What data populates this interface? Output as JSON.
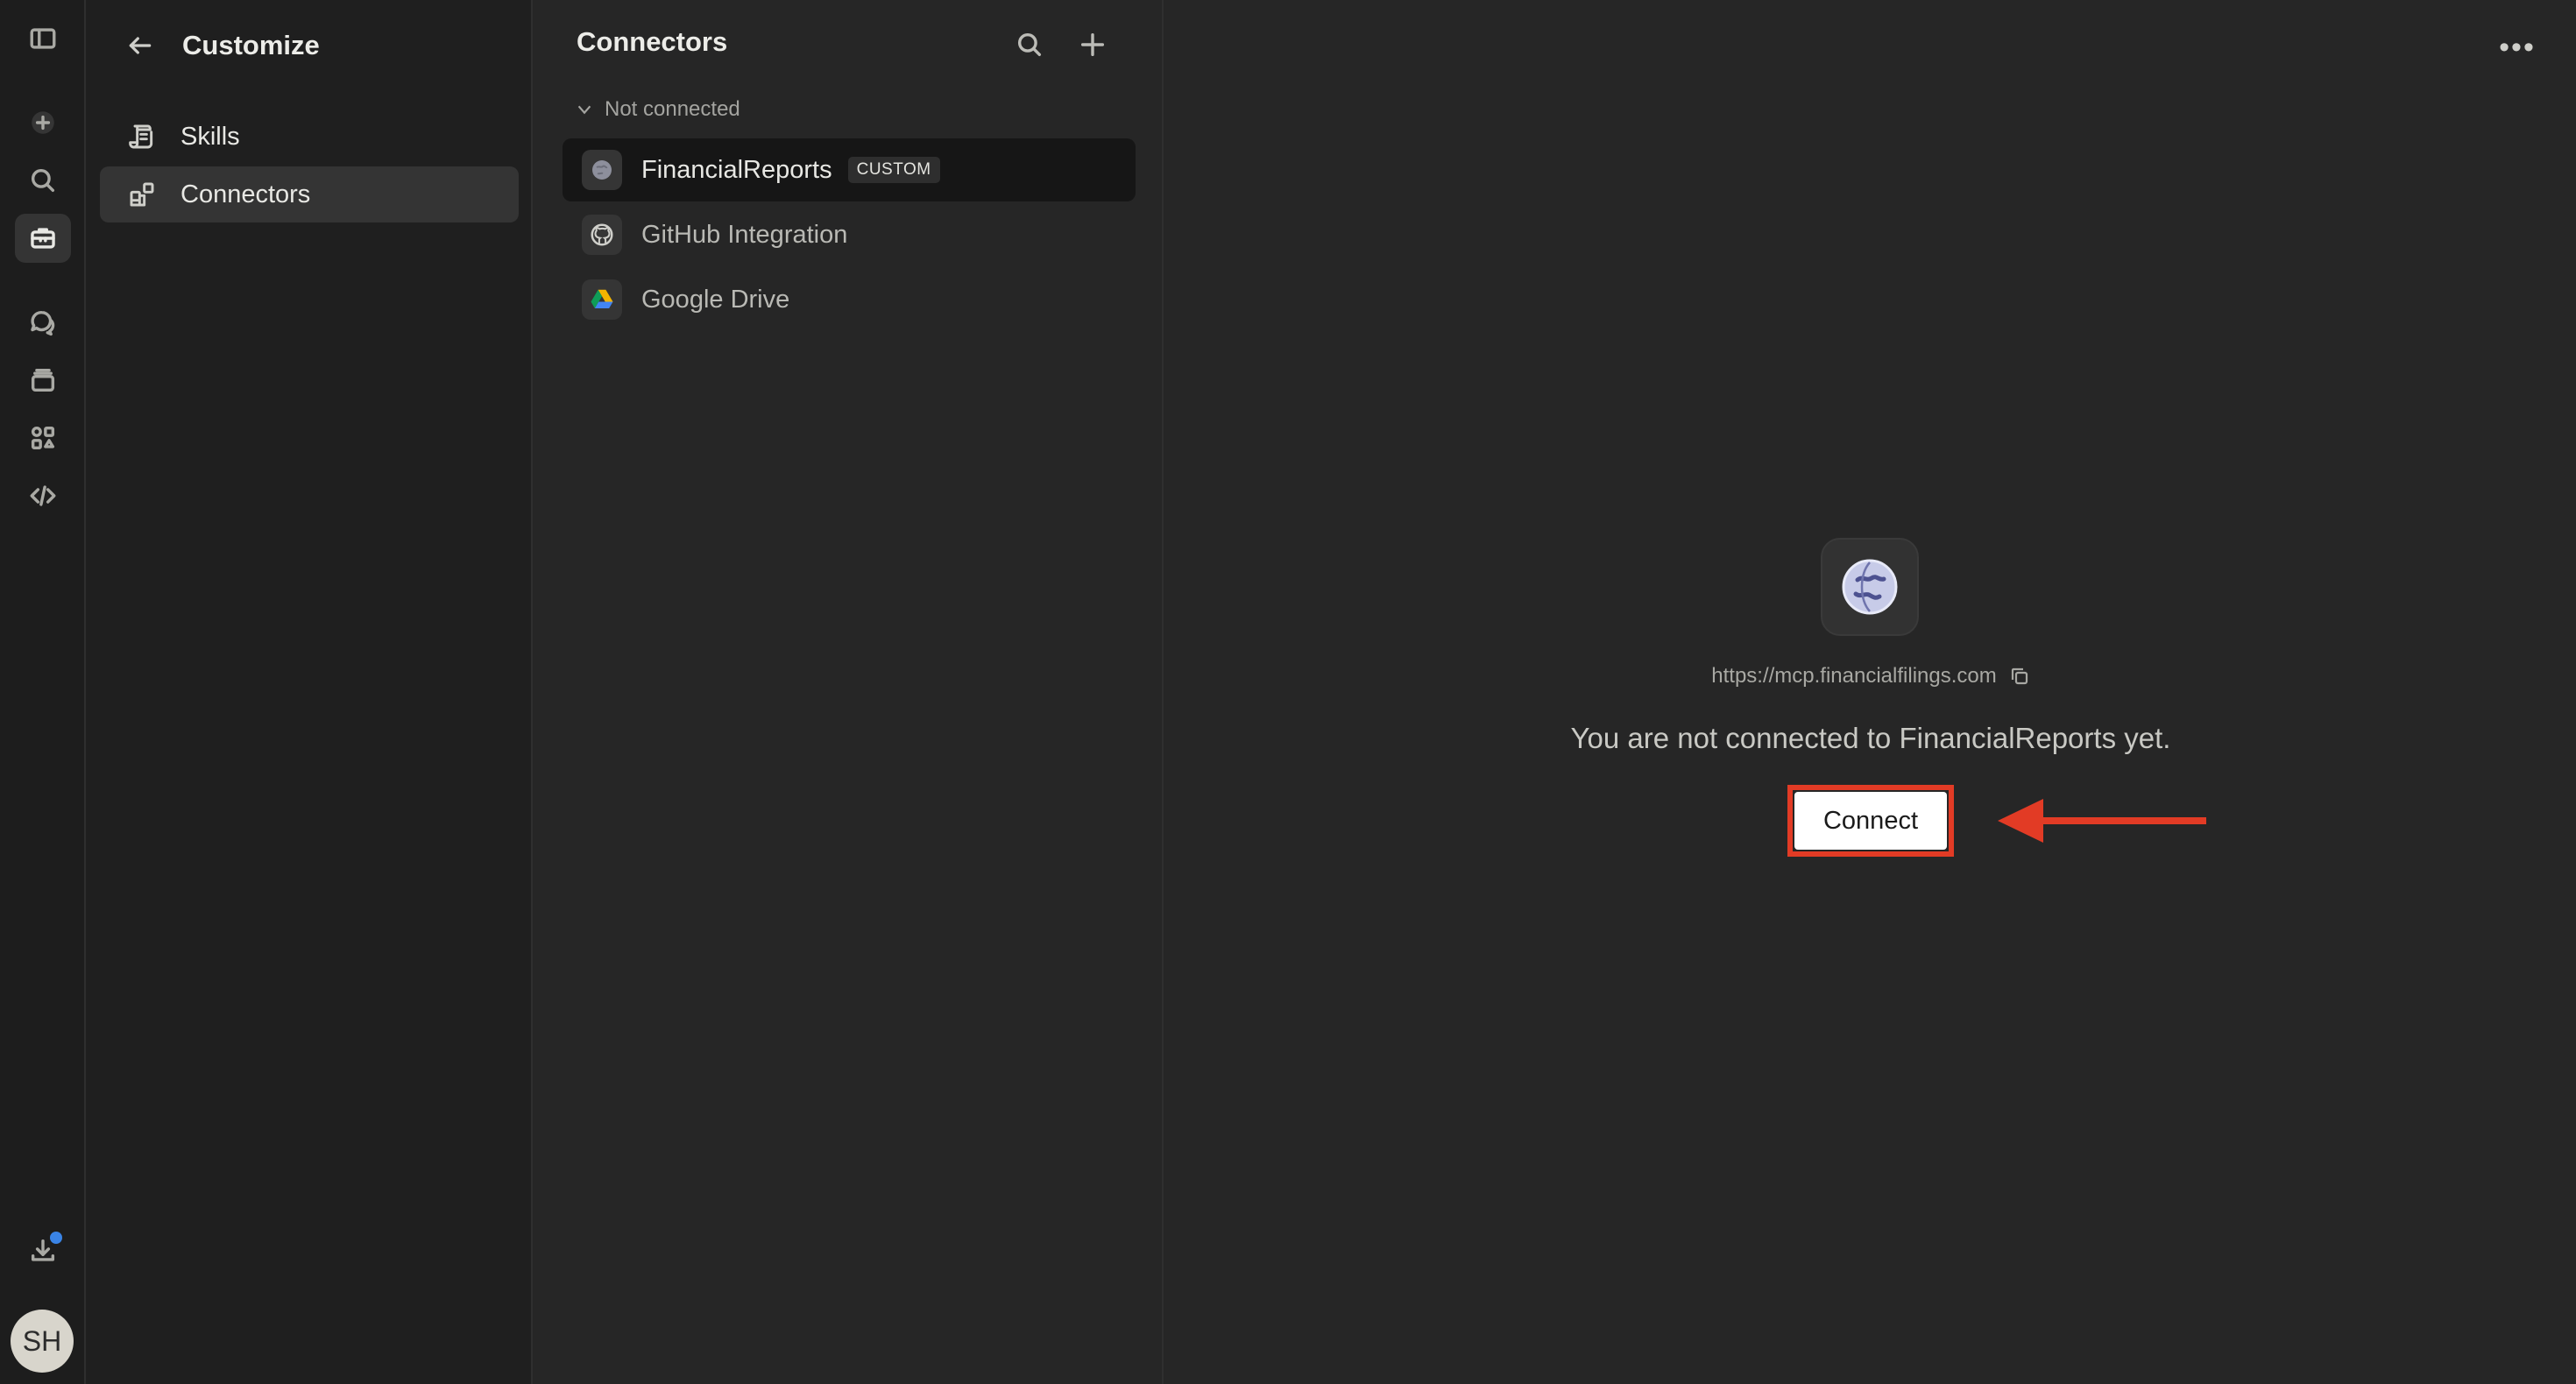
{
  "rail": {
    "items": [
      "sidebar-toggle",
      "new",
      "search",
      "customize",
      "chats",
      "projects",
      "artifacts",
      "code"
    ],
    "avatar_initials": "SH",
    "notification_color": "#3a84e6"
  },
  "customize": {
    "title": "Customize",
    "nav": [
      {
        "label": "Skills",
        "icon": "skills-icon",
        "active": false
      },
      {
        "label": "Connectors",
        "icon": "connectors-icon",
        "active": true
      }
    ]
  },
  "connectors": {
    "title": "Connectors",
    "group_label": "Not connected",
    "items": [
      {
        "name": "FinancialReports",
        "badge": "CUSTOM",
        "icon": "globe-icon",
        "active": true
      },
      {
        "name": "GitHub Integration",
        "icon": "github-icon",
        "active": false
      },
      {
        "name": "Google Drive",
        "icon": "google-drive-icon",
        "active": false
      }
    ]
  },
  "detail": {
    "url": "https://mcp.financialfilings.com",
    "message": "You are not connected to FinancialReports yet.",
    "connect_label": "Connect",
    "highlight_color": "#e23b25"
  }
}
